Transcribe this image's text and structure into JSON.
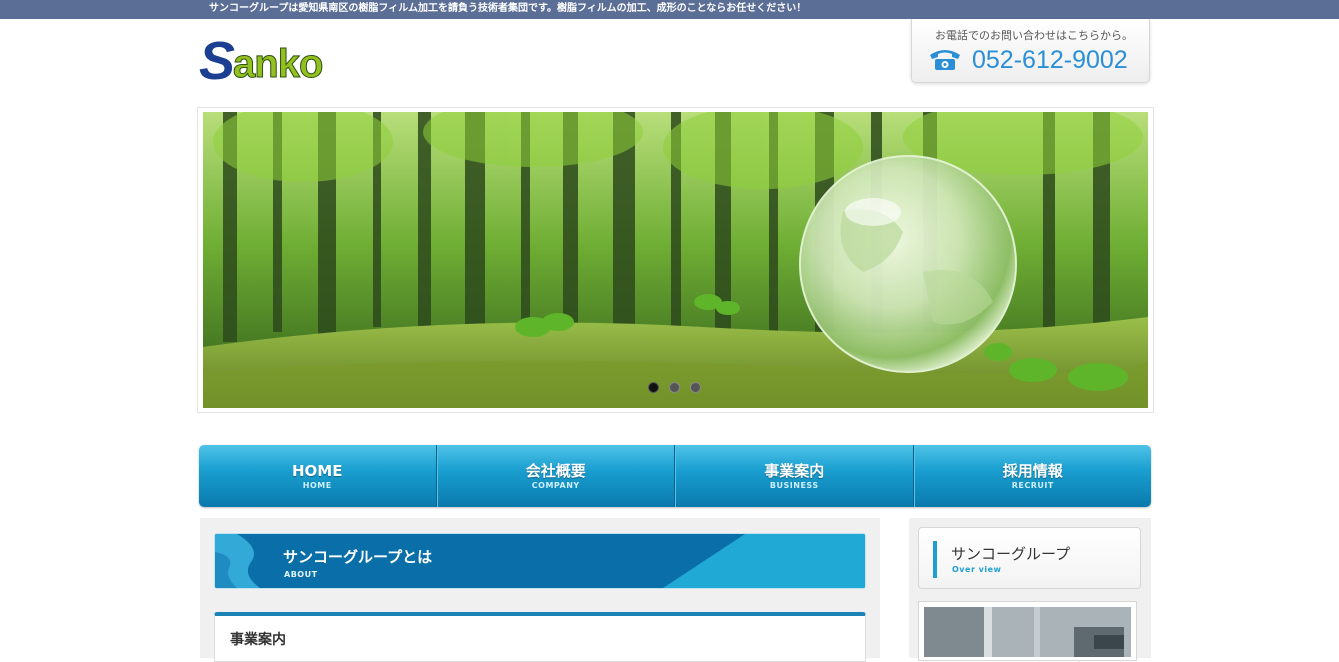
{
  "topbar": {
    "tagline": "サンコーグループは愛知県南区の樹脂フィルム加工を請負う技術者集団です。樹脂フィルムの加工、成形のことならお任せください！"
  },
  "header": {
    "logo": {
      "initial": "S",
      "rest": "anko"
    },
    "phone": {
      "label": "お電話でのお問い合わせはこちらから。",
      "number": "052-612-9002",
      "icon": "telephone-icon"
    }
  },
  "slider": {
    "dots_count": 3,
    "active_index": 0
  },
  "nav": {
    "items": [
      {
        "label": "HOME",
        "sub": "HOME"
      },
      {
        "label": "会社概要",
        "sub": "COMPANY"
      },
      {
        "label": "事業案内",
        "sub": "BUSINESS"
      },
      {
        "label": "採用情報",
        "sub": "RECRUIT"
      }
    ]
  },
  "main": {
    "about": {
      "title": "サンコーグループとは",
      "sub": "ABOUT"
    },
    "business": {
      "title": "事業案内"
    }
  },
  "sidebar": {
    "head": {
      "title": "サンコーグループ",
      "sub": "Over view"
    }
  },
  "colors": {
    "topbar": "#5b6e96",
    "nav_blue": "#1a9fd0",
    "accent_blue": "#0072ac",
    "logo_green": "#94c11f",
    "logo_navy": "#1c3f91",
    "phone_blue": "#2a8fd6"
  }
}
